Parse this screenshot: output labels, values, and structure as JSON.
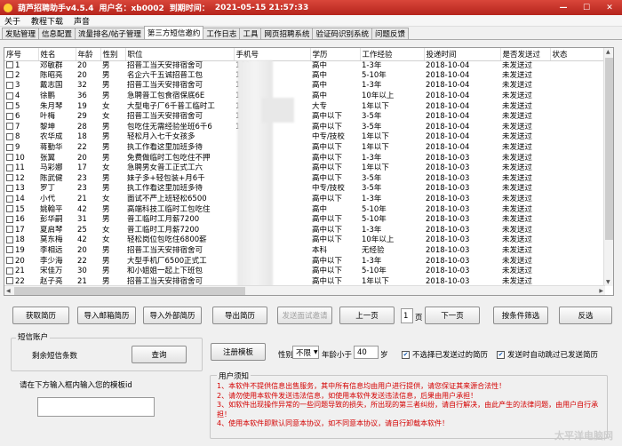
{
  "titlebar": {
    "app_name": "葫芦招聘助手v4.5.4",
    "user_label": "用户名：xb0002",
    "expire_label": "到期时间：",
    "expire_value": "2021-05-15 21:57:33"
  },
  "menu": [
    "关于",
    "教程下载",
    "声音"
  ],
  "tabs": [
    "发贴管理",
    "信息配置",
    "流量排名/帖子管理",
    "第三方短信邀约",
    "工作日志",
    "工具",
    "网页招聘系统",
    "验证码识别系统",
    "问题反馈"
  ],
  "active_tab": 3,
  "table": {
    "headers": [
      "序号",
      "姓名",
      "年龄",
      "性别",
      "职位",
      "手机号",
      "学历",
      "工作经验",
      "投递时间",
      "是否发送过",
      "状态"
    ],
    "rows": [
      [
        "1",
        "邓敏群",
        "20",
        "男",
        "招普工当天安排宿舍可",
        "160",
        "高中",
        "1-3年",
        "2018-10-04",
        "未发送过",
        ""
      ],
      [
        "2",
        "陈昭亮",
        "20",
        "男",
        "名企六千五诚招普工包",
        "13",
        "高中",
        "5-10年",
        "2018-10-04",
        "未发送过",
        ""
      ],
      [
        "3",
        "戴志国",
        "32",
        "男",
        "招普工当天安排宿舍可",
        "13",
        "高中",
        "1-3年",
        "2018-10-04",
        "未发送过",
        ""
      ],
      [
        "4",
        "徐鹏",
        "36",
        "男",
        "急聘普工包食宿保底6E",
        "13",
        "高中",
        "10年以上",
        "2018-10-04",
        "未发送过",
        ""
      ],
      [
        "5",
        "朱月琴",
        "19",
        "女",
        "大型电子厂6千普工临时工",
        "15",
        "大专",
        "1年以下",
        "2018-10-04",
        "未发送过",
        ""
      ],
      [
        "6",
        "叶梅",
        "29",
        "女",
        "招普工当天安排宿舍可",
        "18",
        "高中以下",
        "3-5年",
        "2018-10-04",
        "未发送过",
        ""
      ],
      [
        "7",
        "黎坤",
        "28",
        "男",
        "包吃住无需经验坐班6千6",
        "15",
        "高中以下",
        "3-5年",
        "2018-10-04",
        "未发送过",
        ""
      ],
      [
        "8",
        "农华成",
        "18",
        "男",
        "轻松月入七千女孩多",
        "",
        "中专/技校",
        "1年以下",
        "2018-10-04",
        "未发送过",
        ""
      ],
      [
        "9",
        "蒋勤华",
        "22",
        "男",
        "执工作看这里加班多待",
        "",
        "高中以下",
        "1年以下",
        "2018-10-04",
        "未发送过",
        ""
      ],
      [
        "10",
        "张翼",
        "20",
        "男",
        "免费做临时工包吃住不押",
        "",
        "高中以下",
        "1-3年",
        "2018-10-03",
        "未发送过",
        ""
      ],
      [
        "11",
        "马彩娜",
        "17",
        "女",
        "急聘男女普工正式工六",
        "",
        "高中以下",
        "1年以下",
        "2018-10-03",
        "未发送过",
        ""
      ],
      [
        "12",
        "陈武健",
        "23",
        "男",
        "妹子多+轻包装+月6千",
        "",
        "高中以下",
        "3-5年",
        "2018-10-03",
        "未发送过",
        ""
      ],
      [
        "13",
        "罗丁",
        "23",
        "男",
        "执工作看这里加班多待",
        "",
        "中专/技校",
        "3-5年",
        "2018-10-03",
        "未发送过",
        ""
      ],
      [
        "14",
        "小代",
        "21",
        "女",
        "面试不严上班轻松6500",
        "",
        "高中以下",
        "1-3年",
        "2018-10-03",
        "未发送过",
        ""
      ],
      [
        "15",
        "姚翰平",
        "42",
        "男",
        "高端科技工临时工包吃住",
        "",
        "高中",
        "5-10年",
        "2018-10-03",
        "未发送过",
        ""
      ],
      [
        "16",
        "彭华嗣",
        "31",
        "男",
        "普工临时工月薪7200",
        "",
        "高中以下",
        "5-10年",
        "2018-10-03",
        "未发送过",
        ""
      ],
      [
        "17",
        "夏启琴",
        "25",
        "女",
        "普工临时工月薪7200",
        "",
        "高中以下",
        "1-3年",
        "2018-10-03",
        "未发送过",
        ""
      ],
      [
        "18",
        "莫东梅",
        "42",
        "女",
        "轻松岗位包吃住6800薪",
        "",
        "高中以下",
        "10年以上",
        "2018-10-03",
        "未发送过",
        ""
      ],
      [
        "19",
        "李相远",
        "20",
        "男",
        "招普工当天安排宿舍可",
        "",
        "本科",
        "无经验",
        "2018-10-03",
        "未发送过",
        ""
      ],
      [
        "20",
        "李少海",
        "22",
        "男",
        "大型手机厂6500正式工",
        "",
        "高中以下",
        "1-3年",
        "2018-10-03",
        "未发送过",
        ""
      ],
      [
        "21",
        "宋佳万",
        "30",
        "男",
        "和小姐姐一起上下班包",
        "",
        "高中以下",
        "5-10年",
        "2018-10-03",
        "未发送过",
        ""
      ],
      [
        "22",
        "赵子亮",
        "21",
        "男",
        "招普工当天安排宿舍可",
        "",
        "高中以下",
        "1年以下",
        "2018-10-03",
        "未发送过",
        ""
      ],
      [
        "23",
        "周海兵",
        "17",
        "男",
        "没钱找工作这包吃住可",
        "",
        "高中以下",
        "1年以下",
        "2018-10-03",
        "未发送过",
        ""
      ]
    ]
  },
  "buttons": {
    "fetch": "获取简历",
    "import_mail": "导入邮箱简历",
    "import_external": "导入外部简历",
    "export": "导出简历",
    "send_invite": "发送面试邀请",
    "prev_page": "上一页",
    "page_number": "1",
    "page_unit": "页",
    "next_page": "下一页",
    "filter": "按条件筛选",
    "invert": "反选",
    "query": "查询",
    "register": "注册模板"
  },
  "sms_account": {
    "group_title": "短信账户",
    "remaining_label": "剩余短信条数"
  },
  "filter_panel": {
    "gender_label": "性别",
    "gender_value": "不限",
    "age_label": "年龄小于",
    "age_value": "40",
    "age_unit": "岁"
  },
  "checkboxes": {
    "skip_sent": "不选择已发送过的简历",
    "auto_skip": "发送时自动跳过已发送简历",
    "skip_sent_checked": true,
    "auto_skip_checked": true
  },
  "template": {
    "label": "请在下方输入框内输入您的模板id"
  },
  "notice": {
    "title": "用户须知",
    "lines": [
      "1、本软件不提供信息出售服务，其中所有信息均由用户进行提供，请您保证其来源合法性！",
      "2、请勿使用本软件发送违法信息，如使用本软件发送违法信息，后果由用户承担！",
      "3、如软件出现操作异常的一些问题导致的损失，所出现的第三者纠纷，请自行解决，由此产生的法律问题，由用户自行承担！",
      "4、使用本软件即默认同意本协议，如不同意本协议，请自行卸载本软件！"
    ]
  },
  "watermark": "太平洋电脑网"
}
